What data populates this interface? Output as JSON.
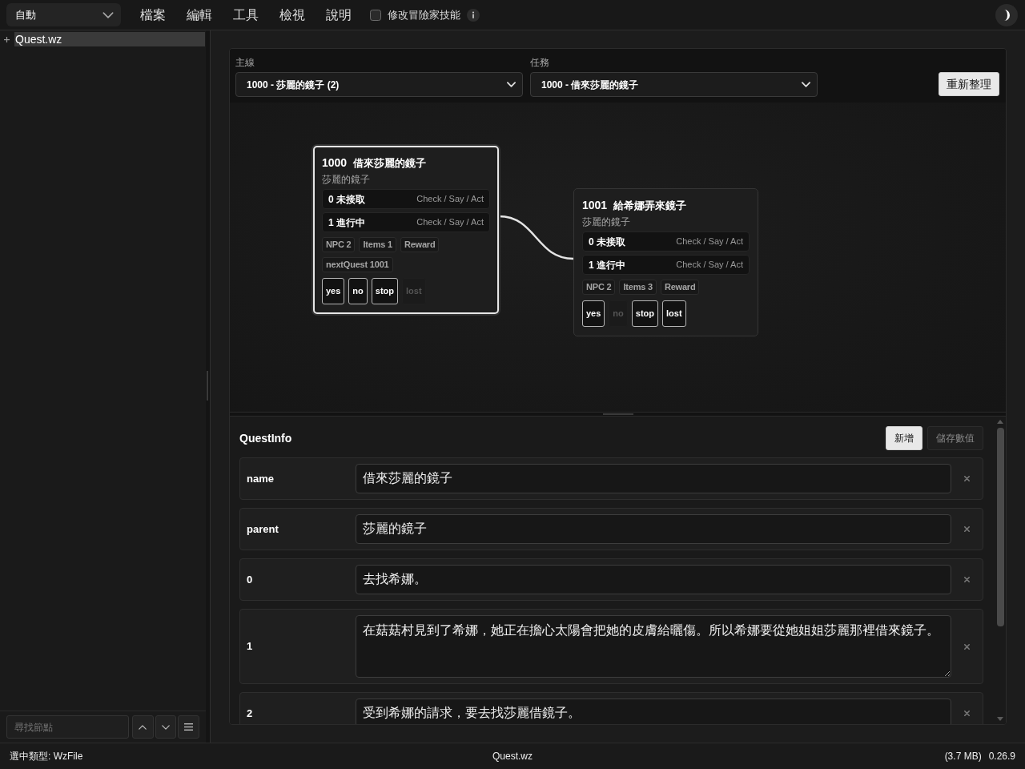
{
  "toolbar": {
    "mode_select": {
      "value": "自動"
    },
    "menu": [
      "檔案",
      "編輯",
      "工具",
      "檢視",
      "說明"
    ],
    "option": {
      "label": "修改冒險家技能",
      "checked": false
    }
  },
  "sidebar": {
    "tree": [
      {
        "label": "Quest.wz",
        "selected": true,
        "expanded": false
      }
    ],
    "search": {
      "placeholder": "尋找節點"
    }
  },
  "quest_panel": {
    "selectors": [
      {
        "label": "主線",
        "value": "1000 - 莎麗的鏡子 (2)"
      },
      {
        "label": "任務",
        "value": "1000 - 借來莎麗的鏡子"
      }
    ],
    "refresh_button": "重新整理",
    "graph": {
      "nodes": [
        {
          "number": "1000",
          "title": "借來莎麗的鏡子",
          "parent": "莎麗的鏡子",
          "selected": true,
          "linked_to_next": true,
          "states": [
            {
              "label": "0 未接取",
              "hint": "Check / Say / Act"
            },
            {
              "label": "1 進行中",
              "hint": "Check / Say / Act"
            }
          ],
          "tags": [
            "NPC 2",
            "Items 1",
            "Reward",
            "nextQuest 1001"
          ],
          "flags": [
            {
              "label": "yes",
              "on": true
            },
            {
              "label": "no",
              "on": true
            },
            {
              "label": "stop",
              "on": true
            },
            {
              "label": "lost",
              "on": false
            }
          ]
        },
        {
          "number": "1001",
          "title": "給希娜弄來鏡子",
          "parent": "莎麗的鏡子",
          "selected": false,
          "linked_to_next": false,
          "states": [
            {
              "label": "0 未接取",
              "hint": "Check / Say / Act"
            },
            {
              "label": "1 進行中",
              "hint": "Check / Say / Act"
            }
          ],
          "tags": [
            "NPC 2",
            "Items 3",
            "Reward"
          ],
          "flags": [
            {
              "label": "yes",
              "on": true
            },
            {
              "label": "no",
              "on": false
            },
            {
              "label": "stop",
              "on": true
            },
            {
              "label": "lost",
              "on": true
            }
          ]
        }
      ]
    },
    "quest_info": {
      "title": "QuestInfo",
      "buttons": [
        {
          "label": "新增",
          "disabled": false
        },
        {
          "label": "儲存數值",
          "disabled": true
        }
      ],
      "rows": [
        {
          "key": "name",
          "kind": "input",
          "value": "借來莎麗的鏡子"
        },
        {
          "key": "parent",
          "kind": "input",
          "value": "莎麗的鏡子"
        },
        {
          "key": "0",
          "kind": "input",
          "value": "去找希娜。"
        },
        {
          "key": "1",
          "kind": "textarea",
          "value": "在菇菇村見到了希娜，她正在擔心太陽會把她的皮膚給曬傷。所以希娜要從她姐姐莎麗那裡借來鏡子。"
        },
        {
          "key": "2",
          "kind": "input",
          "value": "受到希娜的請求，要去找莎麗借鏡子。"
        }
      ]
    }
  },
  "status_bar": {
    "selected_type": "選中類型: WzFile",
    "file": "Quest.wz",
    "size": "(3.7 MB)",
    "version": "0.26.9"
  }
}
